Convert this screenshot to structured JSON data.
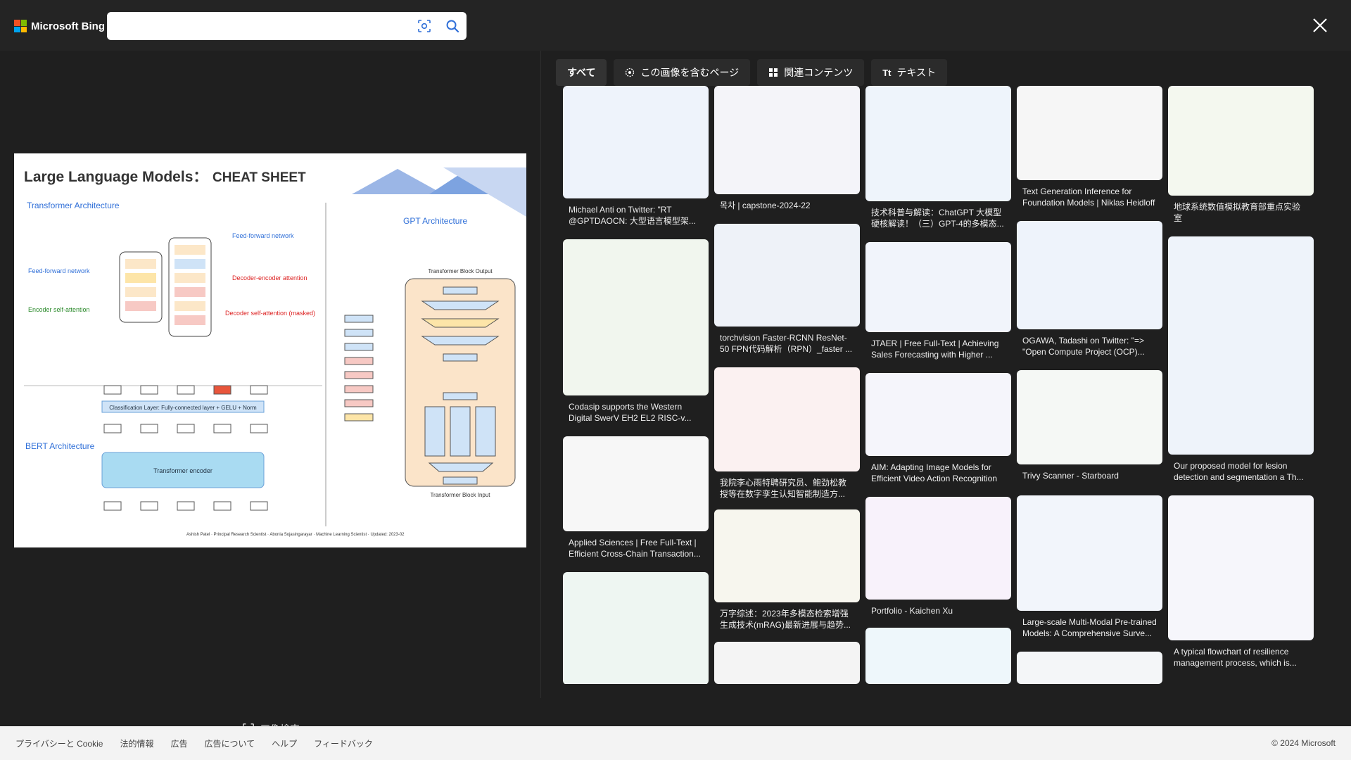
{
  "header": {
    "logo_text": "Microsoft Bing",
    "search_value": "",
    "close_label": "✕"
  },
  "preview": {
    "title_main": "Large Language Models：",
    "title_highlight": "CHEAT SHEET",
    "transformer_label": "Transformer Architecture",
    "gpt_label": "GPT Architecture",
    "bert_label": "BERT Architecture",
    "bert_encoder": "Transformer encoder",
    "bert_classification": "Classification Layer: Fully-connected layer + GELU + Norm",
    "gpt_block_output": "Transformer Block Output",
    "gpt_block_input": "Transformer Block Input",
    "authors": "Ashish Patel · Principal Research Scientist · Abonia Sojasingarayar · Machine Learning Scientist · Updated: 2023-02"
  },
  "visual_search_label": "画像検索",
  "tabs": [
    {
      "label": "すべて",
      "icon": ""
    },
    {
      "label": "この画像を含むページ",
      "icon": "pages-icon"
    },
    {
      "label": "関連コンテンツ",
      "icon": "grid-icon"
    },
    {
      "label": "テキスト",
      "icon": "text-icon"
    }
  ],
  "results": [
    {
      "caption": "Michael Anti on Twitter: \"RT @GPTDAOCN: 大型语言模型架...",
      "tone": "#eef3fb"
    },
    {
      "caption": "Codasip supports the Western Digital SwerV EH2 EL2 RISC-v...",
      "tone": "#f1f6ee"
    },
    {
      "caption": "Applied Sciences | Free Full-Text | Efficient Cross-Chain Transaction...",
      "tone": "#f7f7f7"
    },
    {
      "caption": "",
      "tone": "#eef6f2"
    },
    {
      "caption": "목차 | capstone-2024-22",
      "tone": "#f4f4f9"
    },
    {
      "caption": "torchvision Faster-RCNN ResNet-50 FPN代码解析（RPN）_faster ...",
      "tone": "#eef2f8"
    },
    {
      "caption": "我院李心雨特聘研究员、鲍劲松教授等在数字孪生认知智能制造方...",
      "tone": "#fbf1f1"
    },
    {
      "caption": "万字综述：2023年多模态检索增强生成技术(mRAG)最新进展与趋势...",
      "tone": "#f7f6ee"
    },
    {
      "caption": "",
      "tone": "#f4f4f4"
    },
    {
      "caption": "技术科普与解读：ChatGPT 大模型硬核解读！（三）GPT-4的多模态...",
      "tone": "#eef4fb"
    },
    {
      "caption": "JTAER | Free Full-Text | Achieving Sales Forecasting with Higher ...",
      "tone": "#f1f4fb"
    },
    {
      "caption": "AIM: Adapting Image Models for Efficient Video Action Recognition",
      "tone": "#f5f5fb"
    },
    {
      "caption": "Portfolio - Kaichen Xu",
      "tone": "#f8f2fb"
    },
    {
      "caption": "",
      "tone": "#eef7fb"
    },
    {
      "caption": "Text Generation Inference for Foundation Models | Niklas Heidloff",
      "tone": "#f6f6f6"
    },
    {
      "caption": "OGAWA, Tadashi on Twitter: \"=> \"Open Compute Project (OCP)...",
      "tone": "#eef3fb"
    },
    {
      "caption": "Trivy Scanner - Starboard",
      "tone": "#f5f8f5"
    },
    {
      "caption": "Large-scale Multi-Modal Pre-trained Models: A Comprehensive Surve...",
      "tone": "#f2f5fb"
    },
    {
      "caption": "",
      "tone": "#f4f6f8"
    },
    {
      "caption": "地球系统数值模拟教育部重点实验室",
      "tone": "#f4f8ef"
    },
    {
      "caption": "Our proposed model for lesion detection and segmentation a Th...",
      "tone": "#eef3fa"
    },
    {
      "caption": "A typical flowchart of resilience management process, which is...",
      "tone": "#f6f6fb"
    },
    {
      "caption": "",
      "tone": "#f7f7f7"
    }
  ],
  "footer": {
    "links": [
      "プライバシーと Cookie",
      "法的情報",
      "広告",
      "広告について",
      "ヘルプ",
      "フィードバック"
    ],
    "copyright": "© 2024 Microsoft"
  },
  "colors": {
    "ms_red": "#f25022",
    "ms_green": "#7fba00",
    "ms_blue": "#00a4ef",
    "ms_yellow": "#ffb900",
    "accent_blue": "#2f6fd8"
  }
}
